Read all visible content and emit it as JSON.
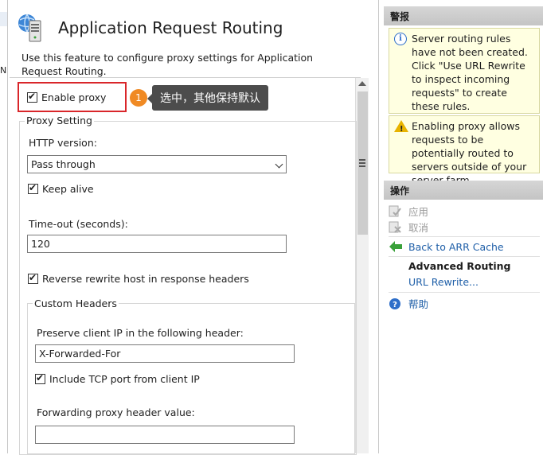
{
  "main": {
    "title": "Application Request Routing",
    "description": "Use this feature to configure proxy settings for Application Request Routing.",
    "enable_proxy": {
      "label": "Enable proxy",
      "checked": true
    },
    "callout": {
      "number": "1",
      "text": "选中，其他保持默认"
    },
    "proxy_setting": {
      "group_label": "Proxy Setting",
      "http_version_label": "HTTP version:",
      "http_version_value": "Pass through",
      "keep_alive": {
        "label": "Keep alive",
        "checked": true
      },
      "timeout_label": "Time-out (seconds):",
      "timeout_value": "120",
      "reverse_rewrite": {
        "label": "Reverse rewrite host in response headers",
        "checked": true
      }
    },
    "custom_headers": {
      "group_label": "Custom Headers",
      "preserve_ip_label": "Preserve client IP in the following header:",
      "preserve_ip_value": "X-Forwarded-For",
      "include_tcp": {
        "label": "Include TCP port from client IP",
        "checked": true
      },
      "forwarding_label": "Forwarding proxy header value:",
      "forwarding_value": ""
    }
  },
  "tree": {
    "partial_letter": "N"
  },
  "actions_pane": {
    "alerts_header": "警报",
    "alerts": [
      {
        "icon": "info-icon",
        "text": "Server routing rules have not been created. Click \"Use URL Rewrite to inspect incoming requests\" to create these rules."
      },
      {
        "icon": "warning-icon",
        "text": "Enabling proxy allows requests to be potentially routed to servers outside of your server farm."
      }
    ],
    "actions_header": "操作",
    "apply": "应用",
    "cancel": "取消",
    "back": "Back to ARR Cache",
    "advanced_routing": "Advanced Routing",
    "url_rewrite": "URL Rewrite...",
    "help": "帮助"
  },
  "colors": {
    "highlight": "#d9262a",
    "callout_badge": "#f08a24",
    "link": "#1f5fa8",
    "alert_bg": "#ffffe1"
  }
}
